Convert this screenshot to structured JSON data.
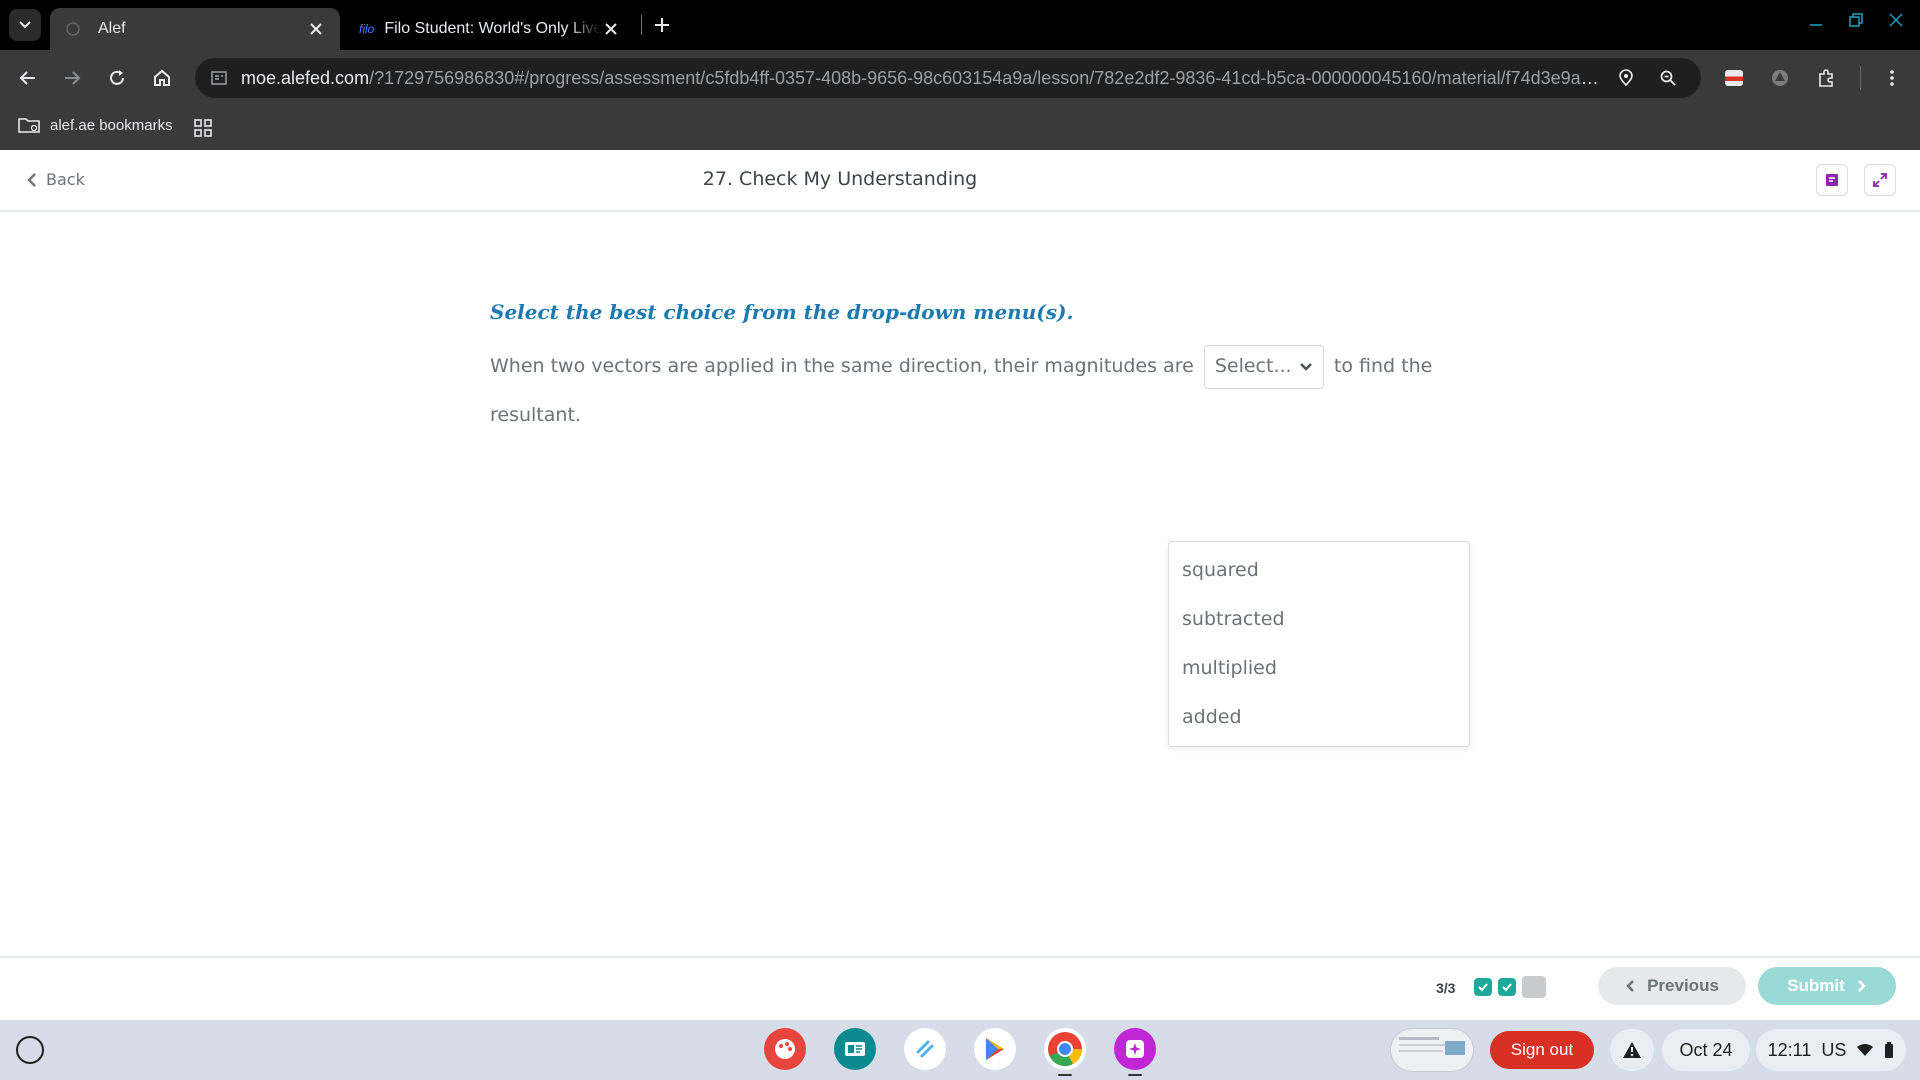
{
  "browser": {
    "tabs": [
      {
        "title": "Alef",
        "active": true
      },
      {
        "title": "Filo Student: World's Only Live Instant Tutoring",
        "favicon_text": "filo",
        "active": false
      }
    ],
    "url_host": "moe.alefed.com",
    "url_rest": "/?1729756986830#/progress/assessment/c5fdb4ff-0357-408b-9656-98c603154a9a/lesson/782e2df2-9836-41cd-b5ca-000000045160/material/f74d3e9a-a...",
    "bookmarks": {
      "folder_label": "alef.ae bookmarks"
    }
  },
  "page": {
    "back_label": "Back",
    "title": "27. Check My Understanding",
    "instruction": "Select the best choice from the drop-down menu(s).",
    "question_before": "When two vectors are applied in the same direction, their magnitudes are",
    "question_after": "to find the",
    "question_end": "resultant.",
    "select_placeholder": "Select...",
    "dropdown_options": [
      "squared",
      "subtracted",
      "multiplied",
      "added"
    ]
  },
  "footer": {
    "progress": "3/3",
    "prev_label": "Previous",
    "submit_label": "Submit"
  },
  "shelf": {
    "signout_label": "Sign out",
    "date": "Oct 24",
    "time": "12:11",
    "locale": "US"
  },
  "colors": {
    "accent_blue": "#1b7ab0",
    "teal_check": "#20a99a",
    "submit_disabled": "#9adad6",
    "signout_red": "#d93025"
  }
}
